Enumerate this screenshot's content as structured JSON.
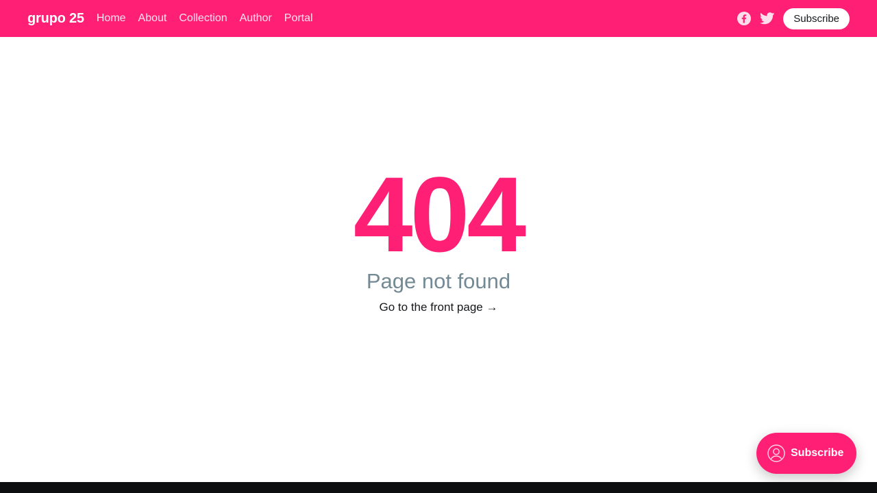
{
  "header": {
    "brand": "grupo 25",
    "nav": [
      {
        "label": "Home"
      },
      {
        "label": "About"
      },
      {
        "label": "Collection"
      },
      {
        "label": "Author"
      },
      {
        "label": "Portal"
      }
    ],
    "social_icons": [
      "facebook-icon",
      "twitter-icon"
    ],
    "subscribe_label": "Subscribe",
    "background_color": "#ff1f75"
  },
  "error": {
    "code": "404",
    "message": "Page not found",
    "link_text": "Go to the front page →",
    "accent_color": "#ff1f75"
  },
  "portal": {
    "label": "Subscribe",
    "icon": "user-icon"
  }
}
